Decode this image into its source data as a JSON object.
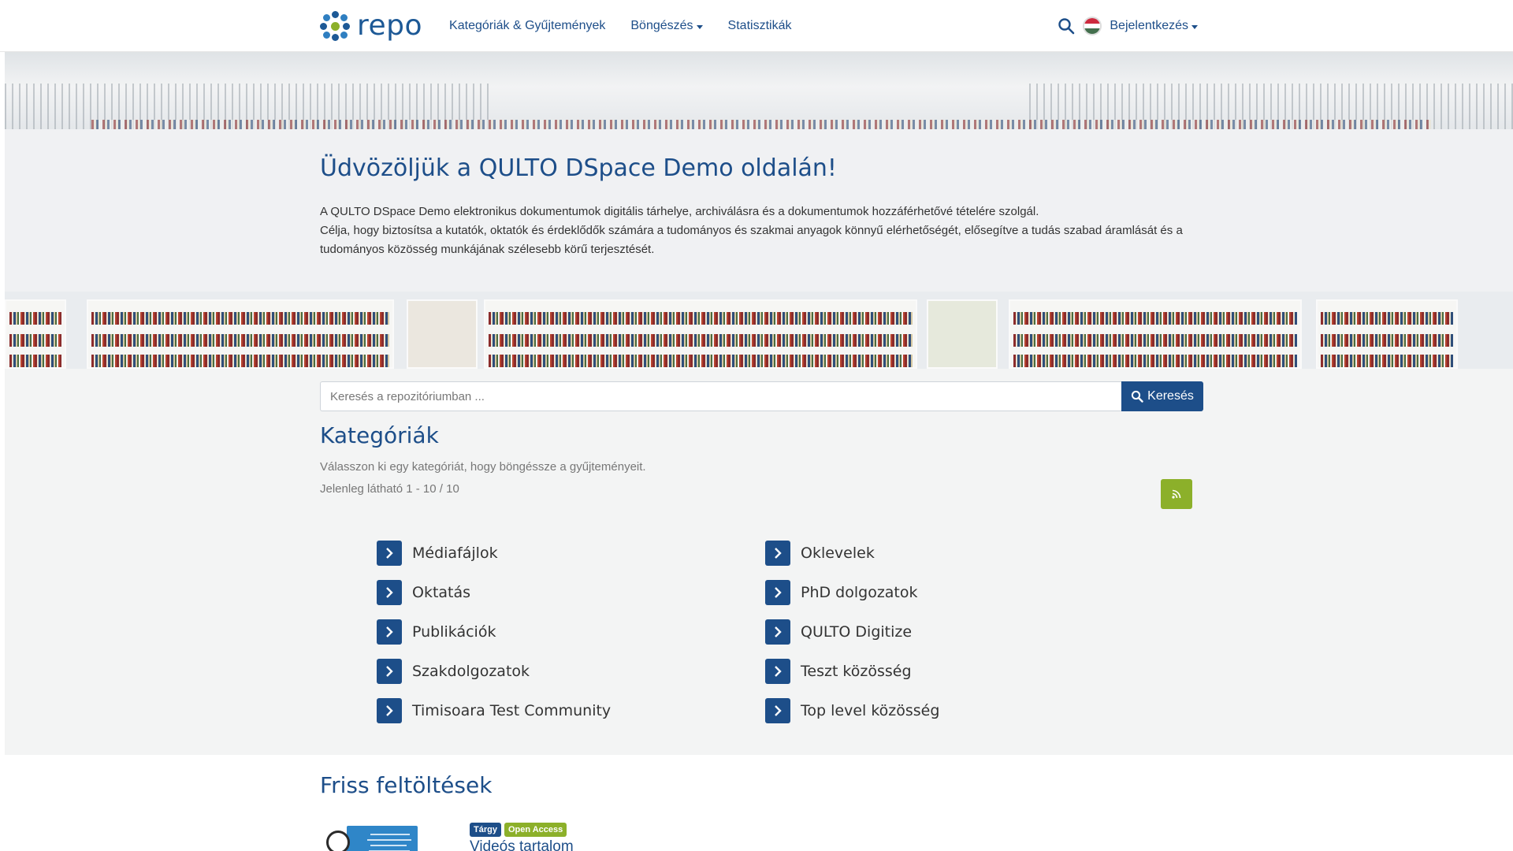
{
  "header": {
    "logo_text": "repo",
    "nav": [
      {
        "label": "Kategóriák & Gyűjtemények",
        "dropdown": false
      },
      {
        "label": "Böngészés",
        "dropdown": true
      },
      {
        "label": "Statisztikák",
        "dropdown": false
      }
    ],
    "login_label": "Bejelentkezés",
    "language": "hu"
  },
  "hero": {
    "title": "Üdvözöljük a QULTO DSpace Demo oldalán!",
    "line1": "A QULTO DSpace Demo elektronikus dokumentumok digitális tárhelye, archiválásra és a dokumentumok hozzáférhetővé tételére szolgál.",
    "line2": "Célja, hogy biztosítsa a kutatók, oktatók és érdeklődők számára a tudományos és szakmai anyagok könnyű elérhetőségét, elősegítve a tudás szabad áramlását és a tudományos közösség munkájának szélesebb körű terjesztését."
  },
  "search": {
    "placeholder": "Keresés a repozitóriumban ...",
    "button_label": "Keresés"
  },
  "categories": {
    "title": "Kategóriák",
    "subtitle": "Válasszon ki egy kategóriát, hogy böngéssze a gyűjteményeit.",
    "count": "Jelenleg látható 1 - 10 / 10",
    "items": [
      "Médiafájlok",
      "Oklevelek",
      "Oktatás",
      "PhD dolgozatok",
      "Publikációk",
      "QULTO Digitize",
      "Szakdolgozatok",
      "Teszt közösség",
      "Timisoara Test Community",
      "Top level közösség"
    ]
  },
  "recent": {
    "title": "Friss feltöltések",
    "item": {
      "badge_type": "Tárgy",
      "badge_access": "Open Access",
      "title": "Videós tartalom"
    }
  },
  "colors": {
    "primary": "#1d4e89",
    "rss": "#8cb02a",
    "open_access": "#8cb02a",
    "section_bg": "#f3f4f4"
  }
}
